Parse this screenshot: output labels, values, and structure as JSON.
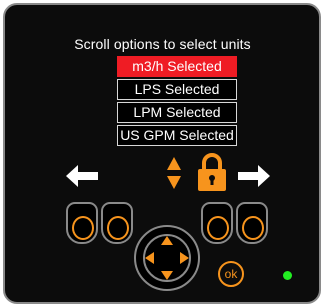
{
  "screen": {
    "title": "Scroll options to select units"
  },
  "unit_options": [
    {
      "label": "m3/h Selected",
      "selected": true
    },
    {
      "label": "LPS Selected",
      "selected": false
    },
    {
      "label": "LPM Selected",
      "selected": false
    },
    {
      "label": "US GPM Selected",
      "selected": false
    }
  ],
  "controls": {
    "ok_label": "ok"
  },
  "icons": {
    "left": "arrow-left-icon",
    "right": "arrow-right-icon",
    "scroll": "up-down-arrows-icon",
    "lock": "padlock-icon"
  },
  "colors": {
    "selected": "#ef1c24",
    "accent": "#f7941d",
    "led": "#22ee22",
    "panel": "#0c0c0c"
  }
}
